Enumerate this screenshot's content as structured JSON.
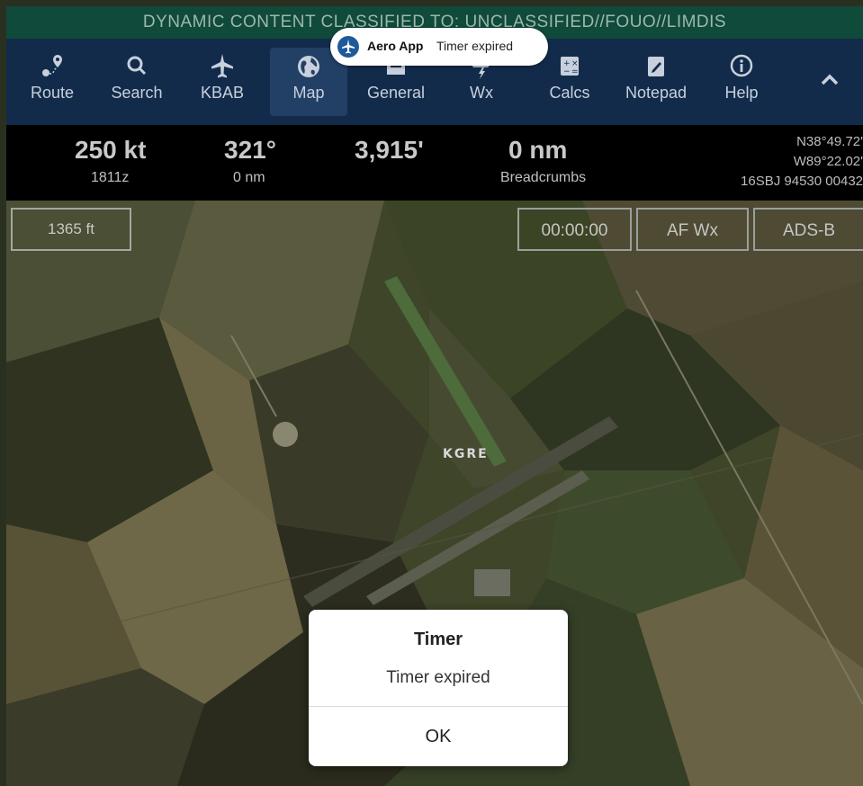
{
  "banner": {
    "text": "DYNAMIC CONTENT CLASSIFIED TO: UNCLASSIFIED//FOUO//LIMDIS"
  },
  "notification": {
    "app": "Aero App",
    "message": "Timer expired"
  },
  "toolbar": {
    "items": [
      {
        "label": "Route",
        "icon": "route-icon"
      },
      {
        "label": "Search",
        "icon": "search-icon"
      },
      {
        "label": "KBAB",
        "icon": "airplane-icon"
      },
      {
        "label": "Map",
        "icon": "globe-icon",
        "active": true
      },
      {
        "label": "General",
        "icon": "book-icon"
      },
      {
        "label": "Wx",
        "icon": "weather-icon"
      },
      {
        "label": "Calcs",
        "icon": "calculator-icon"
      },
      {
        "label": "Notepad",
        "icon": "notepad-icon"
      },
      {
        "label": "Help",
        "icon": "info-icon"
      }
    ],
    "collapse_icon": "chevron-up-icon"
  },
  "infobar": {
    "speed": "250 kt",
    "time": "1811z",
    "heading": "321°",
    "heading_dist": "0 nm",
    "altitude": "3,915'",
    "distance": "0 nm",
    "distance_label": "Breadcrumbs",
    "lat": "N38°49.72'",
    "lon": "W89°22.02'",
    "mgrs": "16SBJ 94530 00432"
  },
  "map": {
    "scale": "1365 ft",
    "timer": "00:00:00",
    "afwx": "AF Wx",
    "adsb": "ADS-B",
    "airport_label": "KGRE"
  },
  "dialog": {
    "title": "Timer",
    "message": "Timer expired",
    "ok": "OK"
  },
  "colors": {
    "banner": "#0f4a3b",
    "toolbar": "#132b4a",
    "toolbar_active": "#223f66",
    "infobar": "#000000"
  }
}
